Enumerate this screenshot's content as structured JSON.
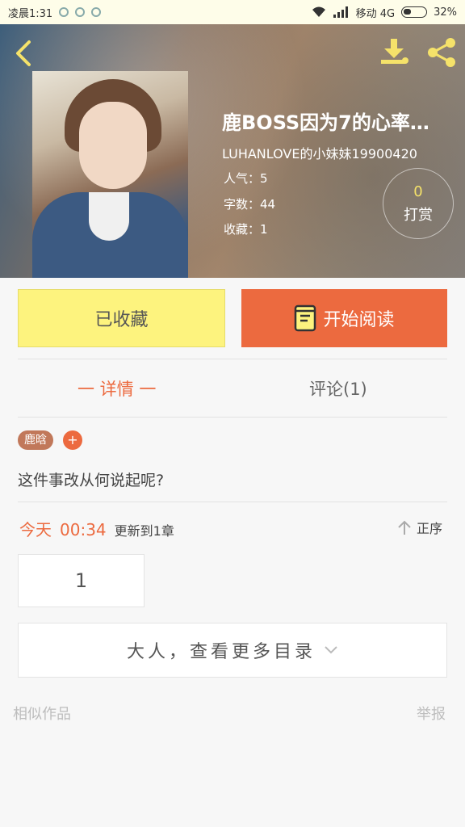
{
  "status_bar": {
    "time": "凌晨1:31",
    "carrier": "移动 4G",
    "battery": "32%"
  },
  "book": {
    "title": "鹿BOSS因为7的心率…",
    "author": "LUHANLOVE的小妹妹19900420",
    "popularity": "人气：5",
    "word_count": "字数：44",
    "favorites": "收藏：1"
  },
  "reward": {
    "count": "0",
    "label": "打赏"
  },
  "actions": {
    "collected_label": "已收藏",
    "read_label": "开始阅读"
  },
  "tabs": {
    "detail": "一 详情 一",
    "comments": "评论(1)"
  },
  "tags": {
    "first": "鹿晗",
    "add": "+"
  },
  "intro": "这件事改从何说起呢?",
  "update": {
    "day": "今天",
    "time": "00:34",
    "text": "更新到1章",
    "order": "正序"
  },
  "chapter": {
    "number": "1"
  },
  "more_catalog": "大人，查看更多目录",
  "footer": {
    "similar": "相似作品",
    "report": "举报"
  },
  "colors": {
    "accent": "#ec6a3f",
    "collected_bg": "#fdf37e",
    "icon_yellow": "#f5e26a"
  },
  "icons": [
    "back-arrow-icon",
    "download-icon",
    "share-icon",
    "book-icon",
    "arrow-up-icon",
    "chevron-down-icon"
  ]
}
